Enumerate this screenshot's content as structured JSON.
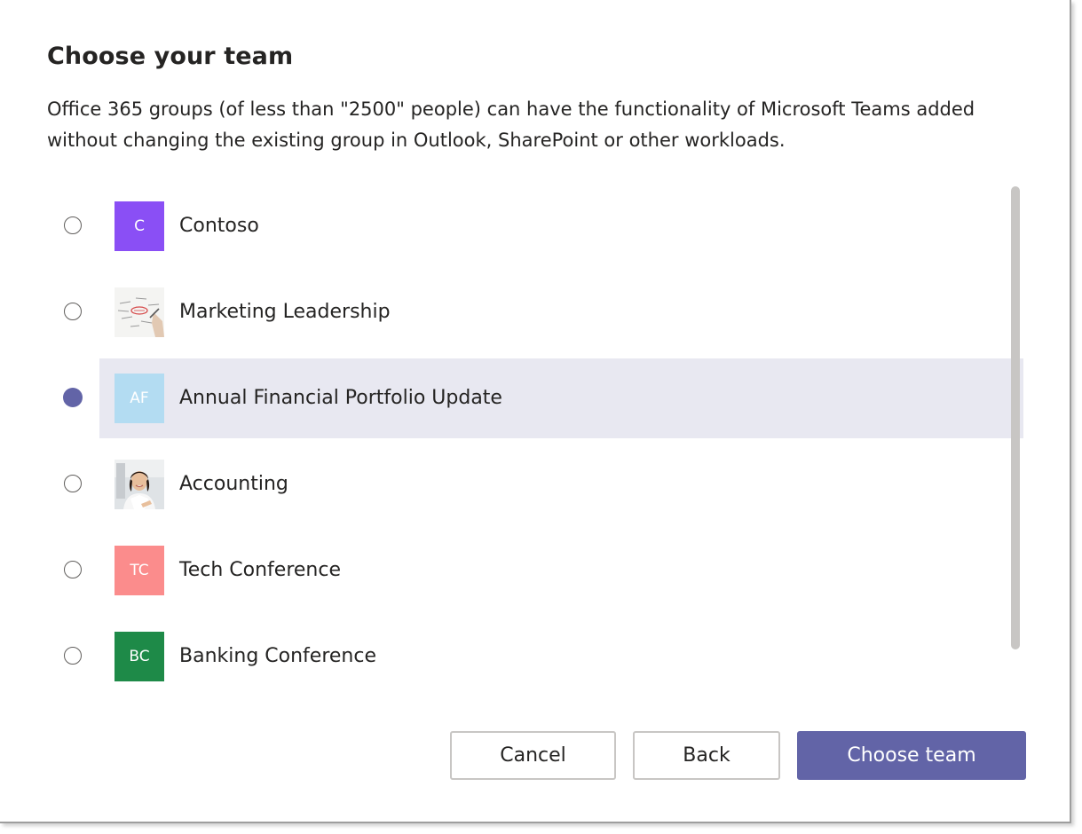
{
  "dialog": {
    "title": "Choose your team",
    "description": "Office 365 groups (of less than \"2500\" people) can have the functionality of Microsoft Teams added without changing the existing group in Outlook, SharePoint or other workloads."
  },
  "teams": [
    {
      "name": "Contoso",
      "initials": "C",
      "avatar_color": "#8a4ff5",
      "avatar_type": "initials",
      "selected": false
    },
    {
      "name": "Marketing Leadership",
      "initials": "",
      "avatar_color": "#f2f2f2",
      "avatar_type": "photo-sketch",
      "selected": false
    },
    {
      "name": "Annual Financial Portfolio Update",
      "initials": "AF",
      "avatar_color": "#b3dcf2",
      "avatar_type": "initials",
      "selected": true
    },
    {
      "name": "Accounting",
      "initials": "",
      "avatar_color": "#f2f2f2",
      "avatar_type": "photo-person",
      "selected": false
    },
    {
      "name": "Tech Conference",
      "initials": "TC",
      "avatar_color": "#fb8c8c",
      "avatar_type": "initials",
      "selected": false
    },
    {
      "name": "Banking Conference",
      "initials": "BC",
      "avatar_color": "#1e8a48",
      "avatar_type": "initials",
      "selected": false
    }
  ],
  "buttons": {
    "cancel_label": "Cancel",
    "back_label": "Back",
    "choose_label": "Choose team"
  },
  "colors": {
    "accent": "#6264a7",
    "selected_row": "#e8e8f1",
    "scrollbar": "#c8c6c4"
  }
}
